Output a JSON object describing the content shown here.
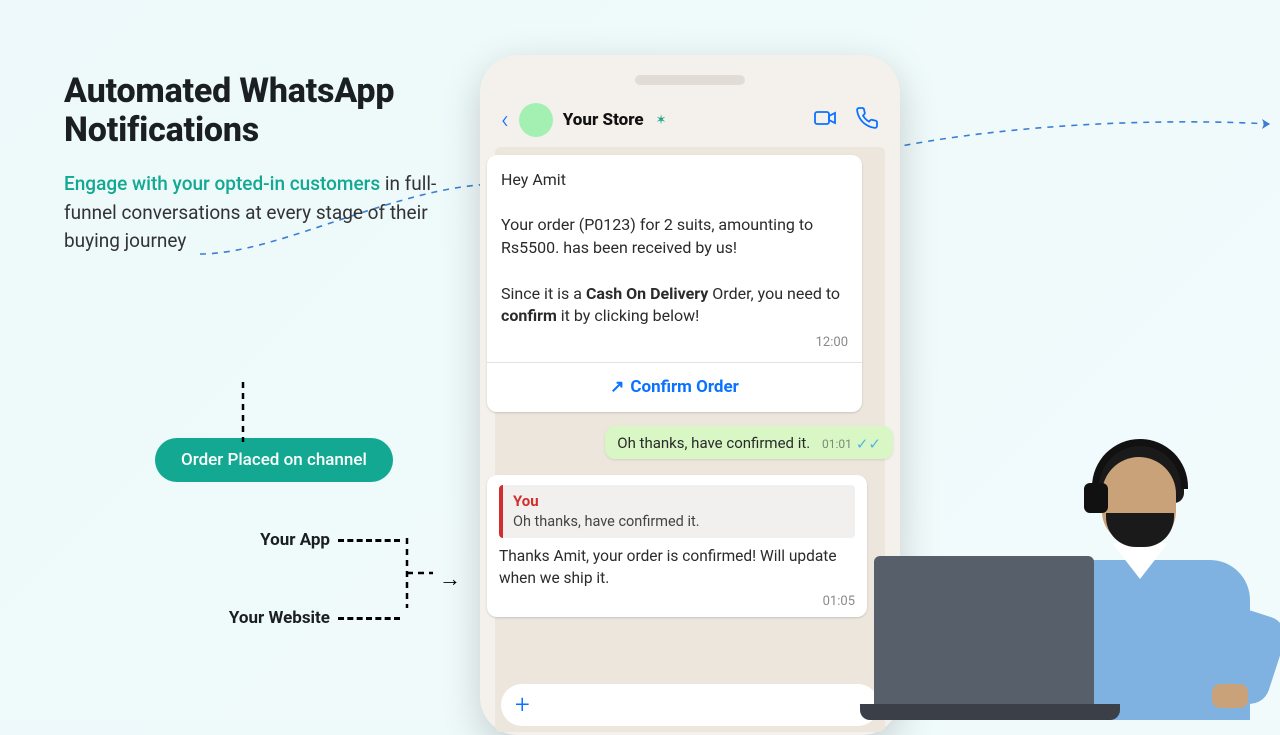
{
  "headline": {
    "line1": "Automated WhatsApp",
    "line2": "Notifications"
  },
  "subhead": {
    "teal_part": "Engage with your opted-in customers",
    "rest": " in full-funnel conversations at every stage of their buying journey"
  },
  "diagram": {
    "pill_label": "Order Placed on channel",
    "channel_app": "Your App",
    "channel_web": "Your Website"
  },
  "phone": {
    "store_name": "Your Store",
    "msg1": {
      "greeting": "Hey Amit",
      "p1a": "Your order (P0123) for 2 suits, amounting to Rs5500. has been received by us!",
      "p2a": "Since it is a ",
      "p2b_bold": "Cash On Delivery",
      "p2c": " Order, you need to ",
      "p2d_bold": "confirm",
      "p2e": " it by clicking below!",
      "time": "12:00",
      "confirm_label": "Confirm Order"
    },
    "msg_out": {
      "text": "Oh thanks, have confirmed it.",
      "time": "01:01"
    },
    "msg_reply": {
      "quote_who": "You",
      "quote_text": "Oh thanks, have confirmed it.",
      "body": "Thanks Amit, your order is confirmed! Will update when we ship it.",
      "time": "01:05"
    }
  }
}
